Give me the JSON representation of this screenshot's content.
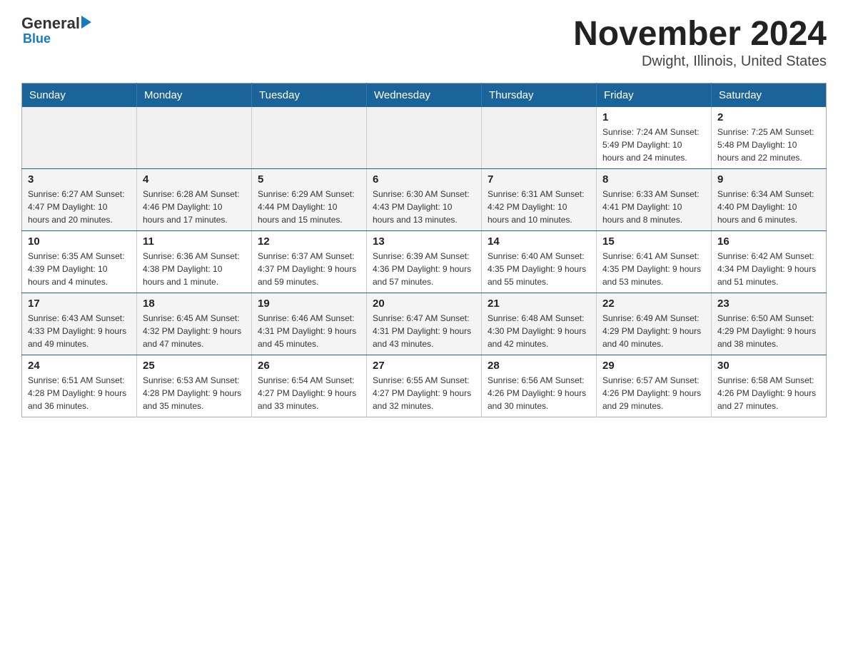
{
  "logo": {
    "general": "General",
    "blue": "Blue"
  },
  "title": "November 2024",
  "subtitle": "Dwight, Illinois, United States",
  "days_of_week": [
    "Sunday",
    "Monday",
    "Tuesday",
    "Wednesday",
    "Thursday",
    "Friday",
    "Saturday"
  ],
  "weeks": [
    [
      {
        "day": "",
        "info": ""
      },
      {
        "day": "",
        "info": ""
      },
      {
        "day": "",
        "info": ""
      },
      {
        "day": "",
        "info": ""
      },
      {
        "day": "",
        "info": ""
      },
      {
        "day": "1",
        "info": "Sunrise: 7:24 AM\nSunset: 5:49 PM\nDaylight: 10 hours and 24 minutes."
      },
      {
        "day": "2",
        "info": "Sunrise: 7:25 AM\nSunset: 5:48 PM\nDaylight: 10 hours and 22 minutes."
      }
    ],
    [
      {
        "day": "3",
        "info": "Sunrise: 6:27 AM\nSunset: 4:47 PM\nDaylight: 10 hours and 20 minutes."
      },
      {
        "day": "4",
        "info": "Sunrise: 6:28 AM\nSunset: 4:46 PM\nDaylight: 10 hours and 17 minutes."
      },
      {
        "day": "5",
        "info": "Sunrise: 6:29 AM\nSunset: 4:44 PM\nDaylight: 10 hours and 15 minutes."
      },
      {
        "day": "6",
        "info": "Sunrise: 6:30 AM\nSunset: 4:43 PM\nDaylight: 10 hours and 13 minutes."
      },
      {
        "day": "7",
        "info": "Sunrise: 6:31 AM\nSunset: 4:42 PM\nDaylight: 10 hours and 10 minutes."
      },
      {
        "day": "8",
        "info": "Sunrise: 6:33 AM\nSunset: 4:41 PM\nDaylight: 10 hours and 8 minutes."
      },
      {
        "day": "9",
        "info": "Sunrise: 6:34 AM\nSunset: 4:40 PM\nDaylight: 10 hours and 6 minutes."
      }
    ],
    [
      {
        "day": "10",
        "info": "Sunrise: 6:35 AM\nSunset: 4:39 PM\nDaylight: 10 hours and 4 minutes."
      },
      {
        "day": "11",
        "info": "Sunrise: 6:36 AM\nSunset: 4:38 PM\nDaylight: 10 hours and 1 minute."
      },
      {
        "day": "12",
        "info": "Sunrise: 6:37 AM\nSunset: 4:37 PM\nDaylight: 9 hours and 59 minutes."
      },
      {
        "day": "13",
        "info": "Sunrise: 6:39 AM\nSunset: 4:36 PM\nDaylight: 9 hours and 57 minutes."
      },
      {
        "day": "14",
        "info": "Sunrise: 6:40 AM\nSunset: 4:35 PM\nDaylight: 9 hours and 55 minutes."
      },
      {
        "day": "15",
        "info": "Sunrise: 6:41 AM\nSunset: 4:35 PM\nDaylight: 9 hours and 53 minutes."
      },
      {
        "day": "16",
        "info": "Sunrise: 6:42 AM\nSunset: 4:34 PM\nDaylight: 9 hours and 51 minutes."
      }
    ],
    [
      {
        "day": "17",
        "info": "Sunrise: 6:43 AM\nSunset: 4:33 PM\nDaylight: 9 hours and 49 minutes."
      },
      {
        "day": "18",
        "info": "Sunrise: 6:45 AM\nSunset: 4:32 PM\nDaylight: 9 hours and 47 minutes."
      },
      {
        "day": "19",
        "info": "Sunrise: 6:46 AM\nSunset: 4:31 PM\nDaylight: 9 hours and 45 minutes."
      },
      {
        "day": "20",
        "info": "Sunrise: 6:47 AM\nSunset: 4:31 PM\nDaylight: 9 hours and 43 minutes."
      },
      {
        "day": "21",
        "info": "Sunrise: 6:48 AM\nSunset: 4:30 PM\nDaylight: 9 hours and 42 minutes."
      },
      {
        "day": "22",
        "info": "Sunrise: 6:49 AM\nSunset: 4:29 PM\nDaylight: 9 hours and 40 minutes."
      },
      {
        "day": "23",
        "info": "Sunrise: 6:50 AM\nSunset: 4:29 PM\nDaylight: 9 hours and 38 minutes."
      }
    ],
    [
      {
        "day": "24",
        "info": "Sunrise: 6:51 AM\nSunset: 4:28 PM\nDaylight: 9 hours and 36 minutes."
      },
      {
        "day": "25",
        "info": "Sunrise: 6:53 AM\nSunset: 4:28 PM\nDaylight: 9 hours and 35 minutes."
      },
      {
        "day": "26",
        "info": "Sunrise: 6:54 AM\nSunset: 4:27 PM\nDaylight: 9 hours and 33 minutes."
      },
      {
        "day": "27",
        "info": "Sunrise: 6:55 AM\nSunset: 4:27 PM\nDaylight: 9 hours and 32 minutes."
      },
      {
        "day": "28",
        "info": "Sunrise: 6:56 AM\nSunset: 4:26 PM\nDaylight: 9 hours and 30 minutes."
      },
      {
        "day": "29",
        "info": "Sunrise: 6:57 AM\nSunset: 4:26 PM\nDaylight: 9 hours and 29 minutes."
      },
      {
        "day": "30",
        "info": "Sunrise: 6:58 AM\nSunset: 4:26 PM\nDaylight: 9 hours and 27 minutes."
      }
    ]
  ]
}
